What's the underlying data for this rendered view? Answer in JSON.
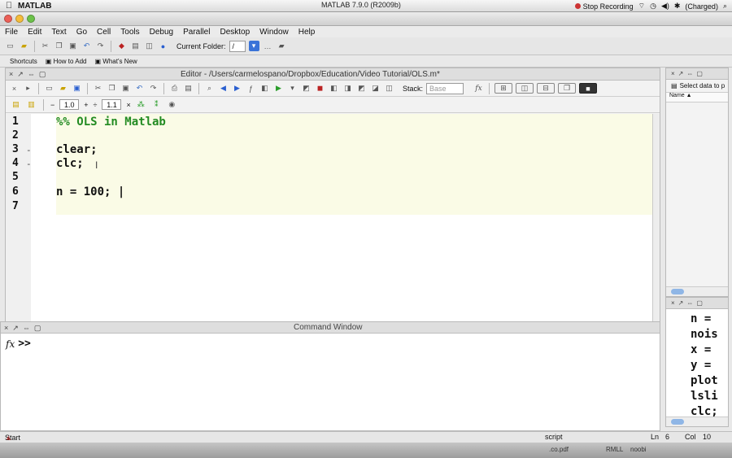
{
  "mac_menubar": {
    "app_name": "MATLAB",
    "window_title": "MATLAB 7.9.0 (R2009b)",
    "stop_recording": "Stop Recording",
    "battery": "(Charged)"
  },
  "menu": [
    "File",
    "Edit",
    "Text",
    "Go",
    "Cell",
    "Tools",
    "Debug",
    "Parallel",
    "Desktop",
    "Window",
    "Help"
  ],
  "toolbar": {
    "current_folder_label": "Current Folder:",
    "current_folder_value": "/"
  },
  "shortcuts": {
    "label": "Shortcuts",
    "how_to_add": "How to Add",
    "whats_new": "What's New"
  },
  "editor": {
    "title": "Editor - /Users/carmelospano/Dropbox/Education/Video Tutorial/OLS.m*",
    "stack_label": "Stack:",
    "stack_value": "Base",
    "cell_val1": "1.0",
    "cell_val2": "1.1",
    "lines": [
      {
        "num": "1",
        "text": "%% OLS in Matlab",
        "dash": ""
      },
      {
        "num": "2",
        "text": "",
        "dash": ""
      },
      {
        "num": "3",
        "text": "clear;",
        "dash": "-"
      },
      {
        "num": "4",
        "text": "clc;",
        "dash": "-"
      },
      {
        "num": "5",
        "text": "",
        "dash": ""
      },
      {
        "num": "6",
        "text": "n = 100; |",
        "dash": ""
      },
      {
        "num": "7",
        "text": "",
        "dash": ""
      }
    ]
  },
  "workspace": {
    "select_data": "Select data to p",
    "name_col": "Name ▲"
  },
  "command_window": {
    "title": "Command Window",
    "fx": "fx",
    "prompt": ">>"
  },
  "history": [
    "n =",
    "nois",
    "x =",
    "y =",
    "plot",
    "lsli",
    "clc;"
  ],
  "status": {
    "start": "Start",
    "mode": "script",
    "ln_label": "Ln",
    "ln": "6",
    "col_label": "Col",
    "col": "10"
  },
  "dock": {
    "item1": ".co.pdf",
    "item2": "RMLL",
    "item3": "noobi"
  }
}
